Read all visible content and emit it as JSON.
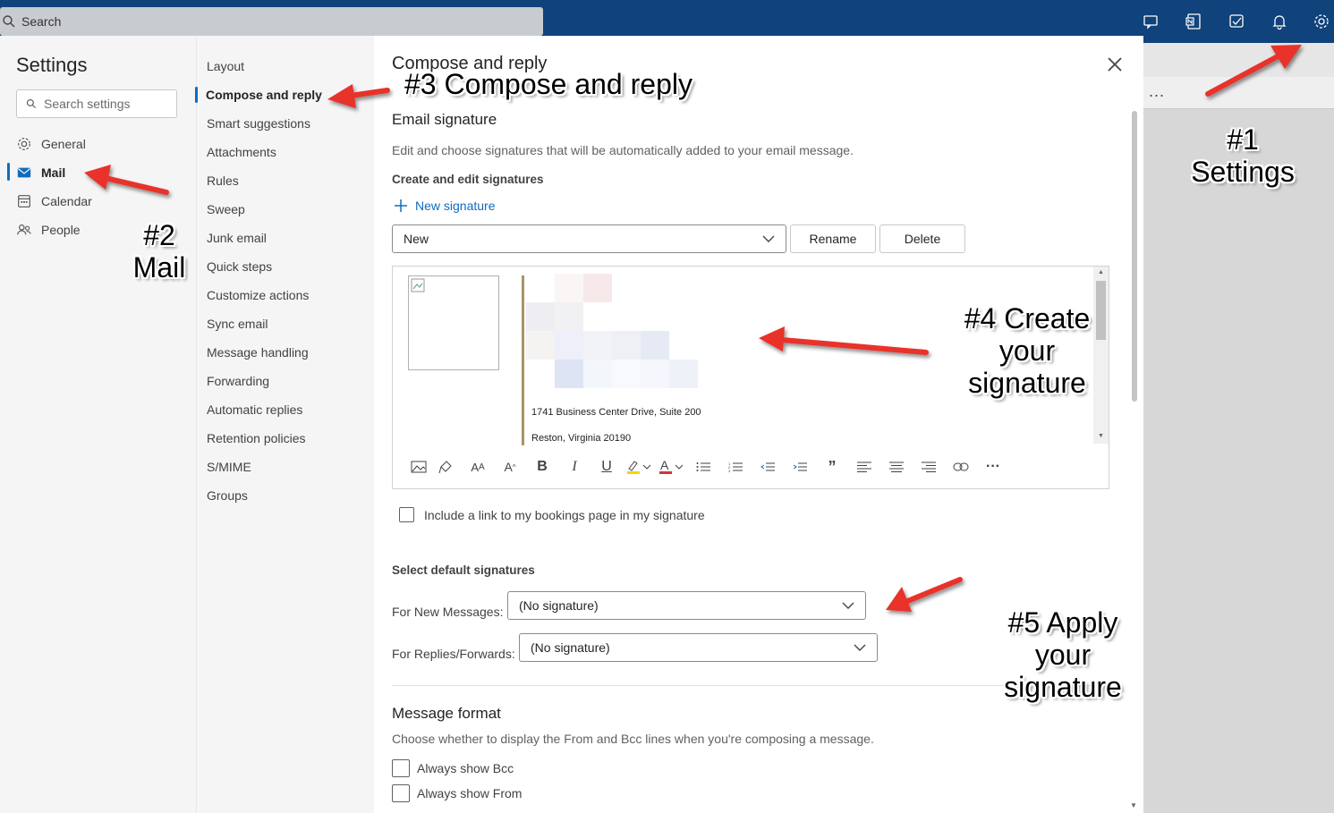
{
  "topbar": {
    "search_placeholder": "Search",
    "icons": [
      "chat-icon",
      "onenote-icon",
      "todo-icon",
      "bell-icon",
      "gear-icon"
    ],
    "bg_color": "#10427b"
  },
  "background": {
    "more_label": "..."
  },
  "settings": {
    "title": "Settings",
    "search_placeholder": "Search settings",
    "categories": [
      {
        "label": "General",
        "icon": "gear-icon"
      },
      {
        "label": "Mail",
        "icon": "mail-icon",
        "selected": true
      },
      {
        "label": "Calendar",
        "icon": "calendar-icon"
      },
      {
        "label": "People",
        "icon": "people-icon"
      }
    ],
    "mail_sections": [
      "Layout",
      "Compose and reply",
      "Smart suggestions",
      "Attachments",
      "Rules",
      "Sweep",
      "Junk email",
      "Quick steps",
      "Customize actions",
      "Sync email",
      "Message handling",
      "Forwarding",
      "Automatic replies",
      "Retention policies",
      "S/MIME",
      "Groups"
    ],
    "selected_section": "Compose and reply"
  },
  "panel": {
    "title": "Compose and reply",
    "email_signature": {
      "heading": "Email signature",
      "description": "Edit and choose signatures that will be automatically added to your email message.",
      "create_label": "Create and edit signatures",
      "new_signature": "New signature",
      "signature_select": "New",
      "rename": "Rename",
      "delete": "Delete",
      "address_line1": "1741 Business Center Drive, Suite 200",
      "address_line2": "Reston, Virginia 20190",
      "bookings_checkbox": "Include a link to my bookings page in my signature"
    },
    "default_signatures": {
      "heading": "Select default signatures",
      "new_messages_label": "For New Messages:",
      "new_messages_value": "(No signature)",
      "replies_label": "For Replies/Forwards:",
      "replies_value": "(No signature)"
    },
    "message_format": {
      "heading": "Message format",
      "description": "Choose whether to display the From and Bcc lines when you're composing a message.",
      "show_bcc": "Always show Bcc",
      "show_from": "Always show From"
    }
  },
  "annotations": {
    "step1": "#1\nSettings",
    "step2": "#2\nMail",
    "step3": "#3 Compose and reply",
    "step4": "#4 Create\nyour\nsignature",
    "step5": "#5 Apply\nyour\nsignature",
    "arrow_color": "#e8312c"
  }
}
